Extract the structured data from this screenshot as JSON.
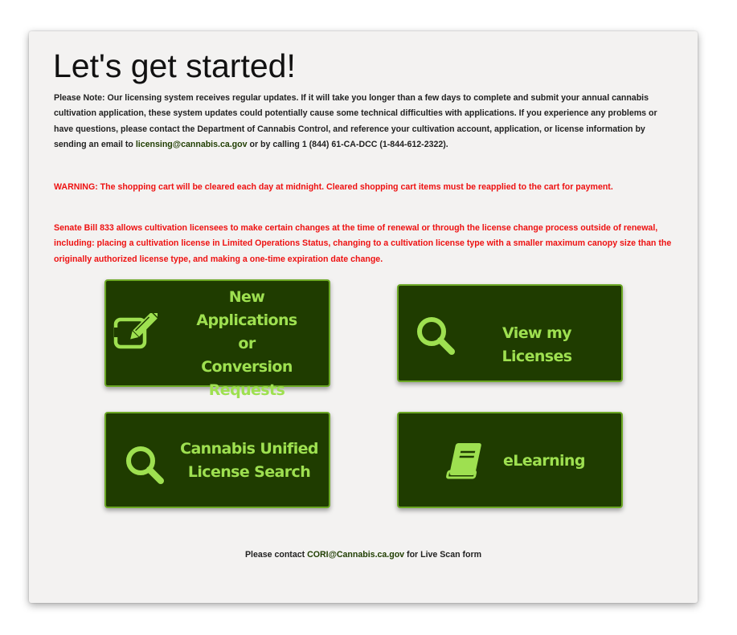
{
  "page": {
    "title": "Let's get started!"
  },
  "note": {
    "text_before": "Please Note: Our licensing system receives regular updates. If it will take you longer than a few days to complete and submit your annual cannabis cultivation application, these system updates could potentially cause some technical difficulties with applications. If you experience any problems or have questions, please contact the Department of Cannabis Control, and reference your cultivation account, application, or license information by sending an email to ",
    "email": "licensing@cannabis.ca.gov",
    "text_after": " or by calling 1 (844) 61-CA-DCC (1-844-612-2322)."
  },
  "warning": {
    "text": "WARNING: The shopping cart will be cleared each day at midnight. Cleared shopping cart items must be reapplied to the cart for payment."
  },
  "senate_bill": {
    "text": "Senate Bill 833 allows cultivation licensees to make certain changes at the time of renewal or through the license change process outside of renewal, including: placing a cultivation license in Limited Operations Status, changing to a cultivation license type with a smaller maximum canopy size than the originally authorized license type, and making a one-time expiration date change."
  },
  "tiles": {
    "new_applications": {
      "line1": "New Applications",
      "line2": "or",
      "line3": "Conversion",
      "line4": "Requests",
      "icon": "edit-icon"
    },
    "view_licenses": {
      "label": "View my Licenses",
      "icon": "search-icon"
    },
    "license_search": {
      "line1": "Cannabis Unified",
      "line2": "License Search",
      "icon": "search-icon"
    },
    "elearning": {
      "label": "eLearning",
      "icon": "book-icon"
    }
  },
  "footer": {
    "text_before": "Please contact ",
    "email": "CORI@Cannabis.ca.gov",
    "text_after": " for Live Scan form"
  },
  "colors": {
    "tile_background": "#1f3c00",
    "tile_border": "#6ca825",
    "tile_text": "#9ee050",
    "warning_text": "#ee1111",
    "card_background": "#f3f2f1"
  }
}
